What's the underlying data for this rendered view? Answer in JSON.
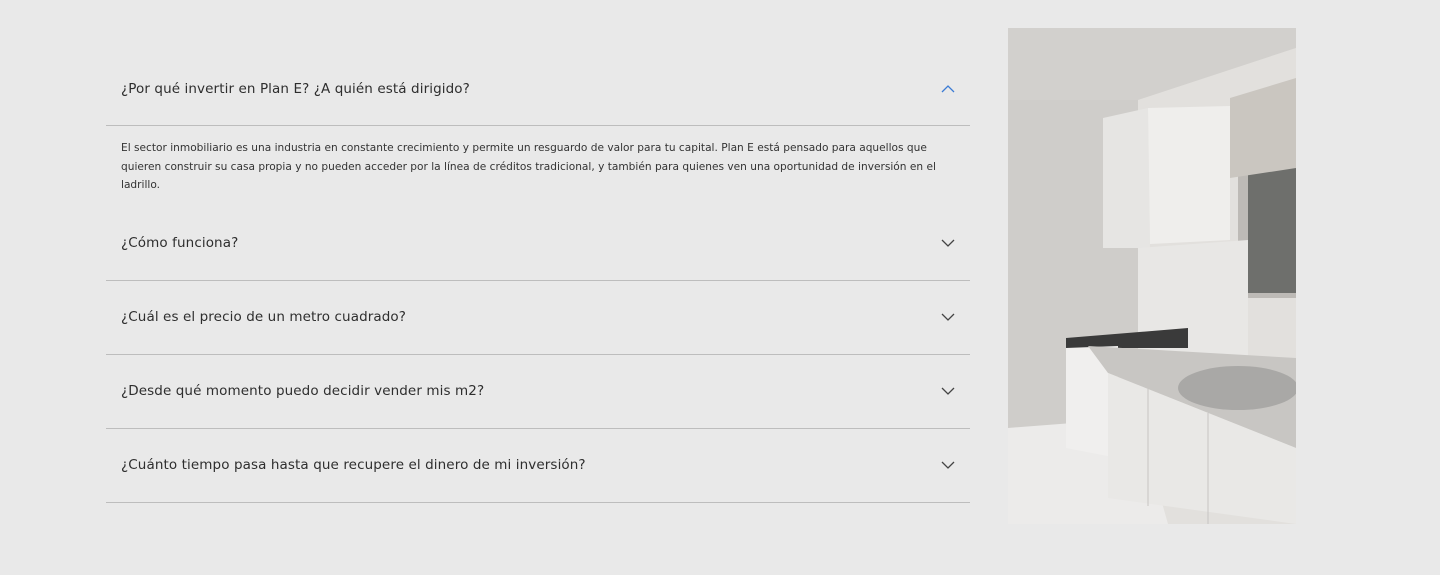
{
  "faq": {
    "items": [
      {
        "question": "¿Por qué invertir en Plan E? ¿A quién está dirigido?",
        "expanded": true,
        "answer": "El sector inmobiliario es una industria en constante crecimiento y permite un resguardo de valor para tu capital. Plan E está pensado para aquellos que quieren construir su casa propia y no pueden acceder por la línea de créditos tradicional, y también para quienes ven una oportunidad de inversión en el ladrillo."
      },
      {
        "question": "¿Cómo funciona?",
        "expanded": false
      },
      {
        "question": "¿Cuál es el precio de un metro cuadrado?",
        "expanded": false
      },
      {
        "question": "¿Desde qué momento puedo decidir vender mis m2?",
        "expanded": false
      },
      {
        "question": "¿Cuánto tiempo pasa hasta que recupere el dinero de mi inversión?",
        "expanded": false
      }
    ]
  },
  "colors": {
    "accent": "#3b7bd4",
    "chevron": "#444444",
    "divider": "#bdbdbd",
    "background": "#e9e9e9"
  }
}
